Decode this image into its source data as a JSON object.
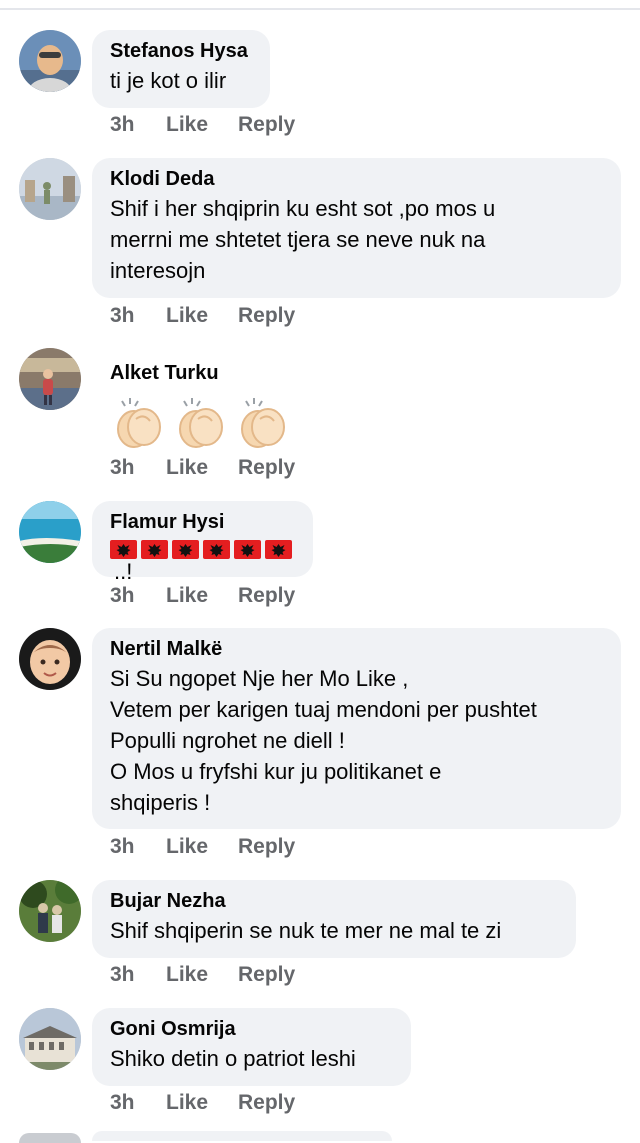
{
  "comments": [
    {
      "author": "Stefanos Hysa",
      "text": "ti je kot o ilir",
      "time": "3h",
      "like": "Like",
      "reply": "Reply",
      "avatar_colors": [
        "#6b8fb8",
        "#e7b98c",
        "#3d3d3d"
      ]
    },
    {
      "author": "Klodi Deda",
      "text": "Shif i her shqiprin ku esht sot ,po mos u\nmerrni me shtetet tjera se neve nuk na\ninteresojn",
      "time": "3h",
      "like": "Like",
      "reply": "Reply",
      "avatar_colors": [
        "#cfd8e3",
        "#7c8c68",
        "#a9b7c6"
      ]
    },
    {
      "author": "Alket Turku",
      "text": "",
      "reactions": "clapping-hands x3",
      "time": "3h",
      "like": "Like",
      "reply": "Reply",
      "avatar_colors": [
        "#8a7a6a",
        "#c8b89a",
        "#5c6f8a"
      ]
    },
    {
      "author": "Flamur Hysi",
      "text": "..!",
      "flags": "albanian-flag x6",
      "time": "3h",
      "like": "Like",
      "reply": "Reply",
      "avatar_colors": [
        "#2a9fc9",
        "#f2f0e6",
        "#3a7d3a"
      ]
    },
    {
      "author": "Nertil Malkë",
      "text": "Si Su ngopet Nje her  Mo Like ,\nVetem per karigen tuaj mendoni per pushtet\nPopulli ngrohet ne diell !\nO Mos u fryfshi kur  ju politikanet e\nshqiperis !",
      "time": "3h",
      "like": "Like",
      "reply": "Reply",
      "avatar_colors": [
        "#1a1a1a",
        "#f2c9a5",
        "#a06a4a"
      ]
    },
    {
      "author": "Bujar Nezha",
      "text": "Shif shqiperin se nuk te mer ne mal te zi",
      "time": "3h",
      "like": "Like",
      "reply": "Reply",
      "avatar_colors": [
        "#5a7d3a",
        "#2e4a1e",
        "#d8c8a8"
      ]
    },
    {
      "author": "Goni Osmrija",
      "text": "Shiko detin o patriot leshi",
      "time": "3h",
      "like": "Like",
      "reply": "Reply",
      "avatar_colors": [
        "#b9c7d8",
        "#6e6b66",
        "#e8e2d6"
      ]
    }
  ],
  "colors": {
    "bubble_bg": "#f0f2f5",
    "name_text": "#050505",
    "meta_text": "#65676b",
    "flag_red": "#e41e20"
  }
}
